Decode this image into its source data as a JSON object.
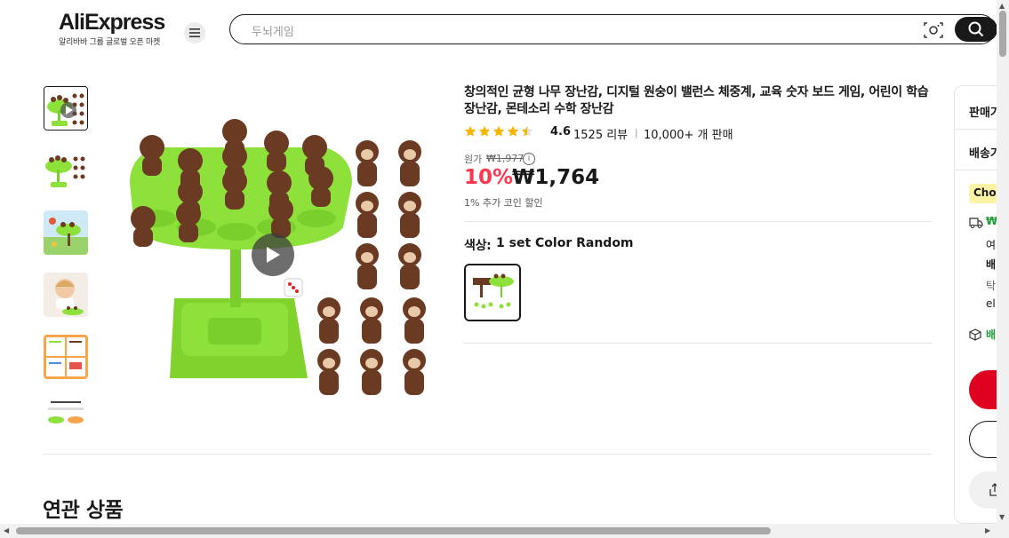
{
  "header": {
    "logo": "AliExpress",
    "logo_sub": "알리바바 그룹 글로벌 오픈 마켓",
    "search_placeholder": "두뇌게임"
  },
  "product": {
    "title": "창의적인 균형 나무 장난감, 디지털 원숭이 밸런스 체중계, 교육 숫자 보드 게임, 어린이 학습 장난감, 몬테소리 수학 장난감",
    "rating": "4.6",
    "stars": 4.5,
    "reviews": "1525 리뷰",
    "separator": "|",
    "sold": "10,000+ 개 판매",
    "original_label": "원가",
    "original_price": "₩1,977",
    "info_icon": "i",
    "discount": "10%",
    "price": "₩1,764",
    "coin_note": "1% 추가 코인 할인",
    "color_label": "색상:",
    "color_value": "1 set Color Random"
  },
  "related_title": "연관 상품",
  "panel": {
    "seller": "판매가",
    "shipping": "배송가",
    "choice": "Choi",
    "ship_price": "₩",
    "line1": "여",
    "line2": "배",
    "line3": "탁",
    "line4": "el",
    "delivery": "배"
  },
  "colors": {
    "accent": "#fd384f",
    "buy": "#e0001f",
    "choice_bg": "#fff3a6",
    "monkey": "#6b3a22",
    "tree": "#8ee03a",
    "ship_green": "#1f9c3a"
  }
}
